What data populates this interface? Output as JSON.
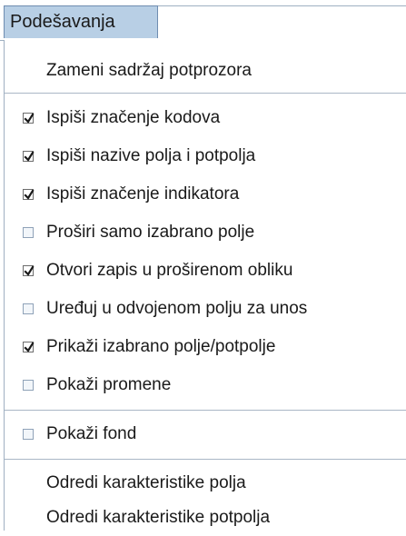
{
  "menu": {
    "title": "Podešavanja",
    "replace_label": "Zameni sadržaj potprozora",
    "options": [
      {
        "label": "Ispiši značenje kodova",
        "checked": true
      },
      {
        "label": "Ispiši nazive polja i potpolja",
        "checked": true
      },
      {
        "label": "Ispiši značenje indikatora",
        "checked": true
      },
      {
        "label": "Proširi samo izabrano polje",
        "checked": false
      },
      {
        "label": "Otvori zapis u proširenom obliku",
        "checked": true
      },
      {
        "label": "Uređuj u odvojenom polju za unos",
        "checked": false
      },
      {
        "label": "Prikaži izabrano polje/potpolje",
        "checked": true
      },
      {
        "label": "Pokaži promene",
        "checked": false
      }
    ],
    "fond": {
      "label": "Pokaži fond",
      "checked": false
    },
    "field_props_label": "Odredi karakteristike polja",
    "subfield_props_label": "Odredi karakteristike potpolja"
  }
}
